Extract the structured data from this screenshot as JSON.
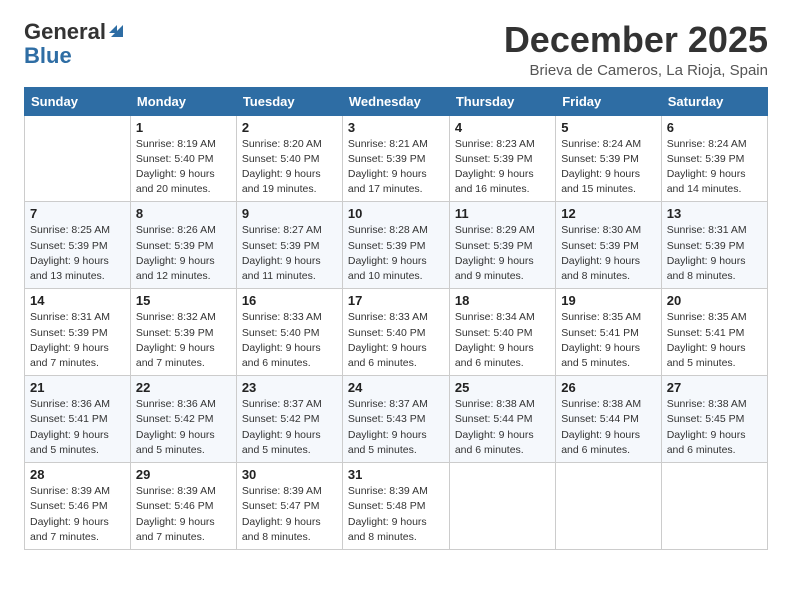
{
  "logo": {
    "general": "General",
    "blue": "Blue"
  },
  "header": {
    "month": "December 2025",
    "location": "Brieva de Cameros, La Rioja, Spain"
  },
  "weekdays": [
    "Sunday",
    "Monday",
    "Tuesday",
    "Wednesday",
    "Thursday",
    "Friday",
    "Saturday"
  ],
  "weeks": [
    [
      {
        "day": "",
        "detail": ""
      },
      {
        "day": "1",
        "detail": "Sunrise: 8:19 AM\nSunset: 5:40 PM\nDaylight: 9 hours\nand 20 minutes."
      },
      {
        "day": "2",
        "detail": "Sunrise: 8:20 AM\nSunset: 5:40 PM\nDaylight: 9 hours\nand 19 minutes."
      },
      {
        "day": "3",
        "detail": "Sunrise: 8:21 AM\nSunset: 5:39 PM\nDaylight: 9 hours\nand 17 minutes."
      },
      {
        "day": "4",
        "detail": "Sunrise: 8:23 AM\nSunset: 5:39 PM\nDaylight: 9 hours\nand 16 minutes."
      },
      {
        "day": "5",
        "detail": "Sunrise: 8:24 AM\nSunset: 5:39 PM\nDaylight: 9 hours\nand 15 minutes."
      },
      {
        "day": "6",
        "detail": "Sunrise: 8:24 AM\nSunset: 5:39 PM\nDaylight: 9 hours\nand 14 minutes."
      }
    ],
    [
      {
        "day": "7",
        "detail": "Sunrise: 8:25 AM\nSunset: 5:39 PM\nDaylight: 9 hours\nand 13 minutes."
      },
      {
        "day": "8",
        "detail": "Sunrise: 8:26 AM\nSunset: 5:39 PM\nDaylight: 9 hours\nand 12 minutes."
      },
      {
        "day": "9",
        "detail": "Sunrise: 8:27 AM\nSunset: 5:39 PM\nDaylight: 9 hours\nand 11 minutes."
      },
      {
        "day": "10",
        "detail": "Sunrise: 8:28 AM\nSunset: 5:39 PM\nDaylight: 9 hours\nand 10 minutes."
      },
      {
        "day": "11",
        "detail": "Sunrise: 8:29 AM\nSunset: 5:39 PM\nDaylight: 9 hours\nand 9 minutes."
      },
      {
        "day": "12",
        "detail": "Sunrise: 8:30 AM\nSunset: 5:39 PM\nDaylight: 9 hours\nand 8 minutes."
      },
      {
        "day": "13",
        "detail": "Sunrise: 8:31 AM\nSunset: 5:39 PM\nDaylight: 9 hours\nand 8 minutes."
      }
    ],
    [
      {
        "day": "14",
        "detail": "Sunrise: 8:31 AM\nSunset: 5:39 PM\nDaylight: 9 hours\nand 7 minutes."
      },
      {
        "day": "15",
        "detail": "Sunrise: 8:32 AM\nSunset: 5:39 PM\nDaylight: 9 hours\nand 7 minutes."
      },
      {
        "day": "16",
        "detail": "Sunrise: 8:33 AM\nSunset: 5:40 PM\nDaylight: 9 hours\nand 6 minutes."
      },
      {
        "day": "17",
        "detail": "Sunrise: 8:33 AM\nSunset: 5:40 PM\nDaylight: 9 hours\nand 6 minutes."
      },
      {
        "day": "18",
        "detail": "Sunrise: 8:34 AM\nSunset: 5:40 PM\nDaylight: 9 hours\nand 6 minutes."
      },
      {
        "day": "19",
        "detail": "Sunrise: 8:35 AM\nSunset: 5:41 PM\nDaylight: 9 hours\nand 5 minutes."
      },
      {
        "day": "20",
        "detail": "Sunrise: 8:35 AM\nSunset: 5:41 PM\nDaylight: 9 hours\nand 5 minutes."
      }
    ],
    [
      {
        "day": "21",
        "detail": "Sunrise: 8:36 AM\nSunset: 5:41 PM\nDaylight: 9 hours\nand 5 minutes."
      },
      {
        "day": "22",
        "detail": "Sunrise: 8:36 AM\nSunset: 5:42 PM\nDaylight: 9 hours\nand 5 minutes."
      },
      {
        "day": "23",
        "detail": "Sunrise: 8:37 AM\nSunset: 5:42 PM\nDaylight: 9 hours\nand 5 minutes."
      },
      {
        "day": "24",
        "detail": "Sunrise: 8:37 AM\nSunset: 5:43 PM\nDaylight: 9 hours\nand 5 minutes."
      },
      {
        "day": "25",
        "detail": "Sunrise: 8:38 AM\nSunset: 5:44 PM\nDaylight: 9 hours\nand 6 minutes."
      },
      {
        "day": "26",
        "detail": "Sunrise: 8:38 AM\nSunset: 5:44 PM\nDaylight: 9 hours\nand 6 minutes."
      },
      {
        "day": "27",
        "detail": "Sunrise: 8:38 AM\nSunset: 5:45 PM\nDaylight: 9 hours\nand 6 minutes."
      }
    ],
    [
      {
        "day": "28",
        "detail": "Sunrise: 8:39 AM\nSunset: 5:46 PM\nDaylight: 9 hours\nand 7 minutes."
      },
      {
        "day": "29",
        "detail": "Sunrise: 8:39 AM\nSunset: 5:46 PM\nDaylight: 9 hours\nand 7 minutes."
      },
      {
        "day": "30",
        "detail": "Sunrise: 8:39 AM\nSunset: 5:47 PM\nDaylight: 9 hours\nand 8 minutes."
      },
      {
        "day": "31",
        "detail": "Sunrise: 8:39 AM\nSunset: 5:48 PM\nDaylight: 9 hours\nand 8 minutes."
      },
      {
        "day": "",
        "detail": ""
      },
      {
        "day": "",
        "detail": ""
      },
      {
        "day": "",
        "detail": ""
      }
    ]
  ]
}
